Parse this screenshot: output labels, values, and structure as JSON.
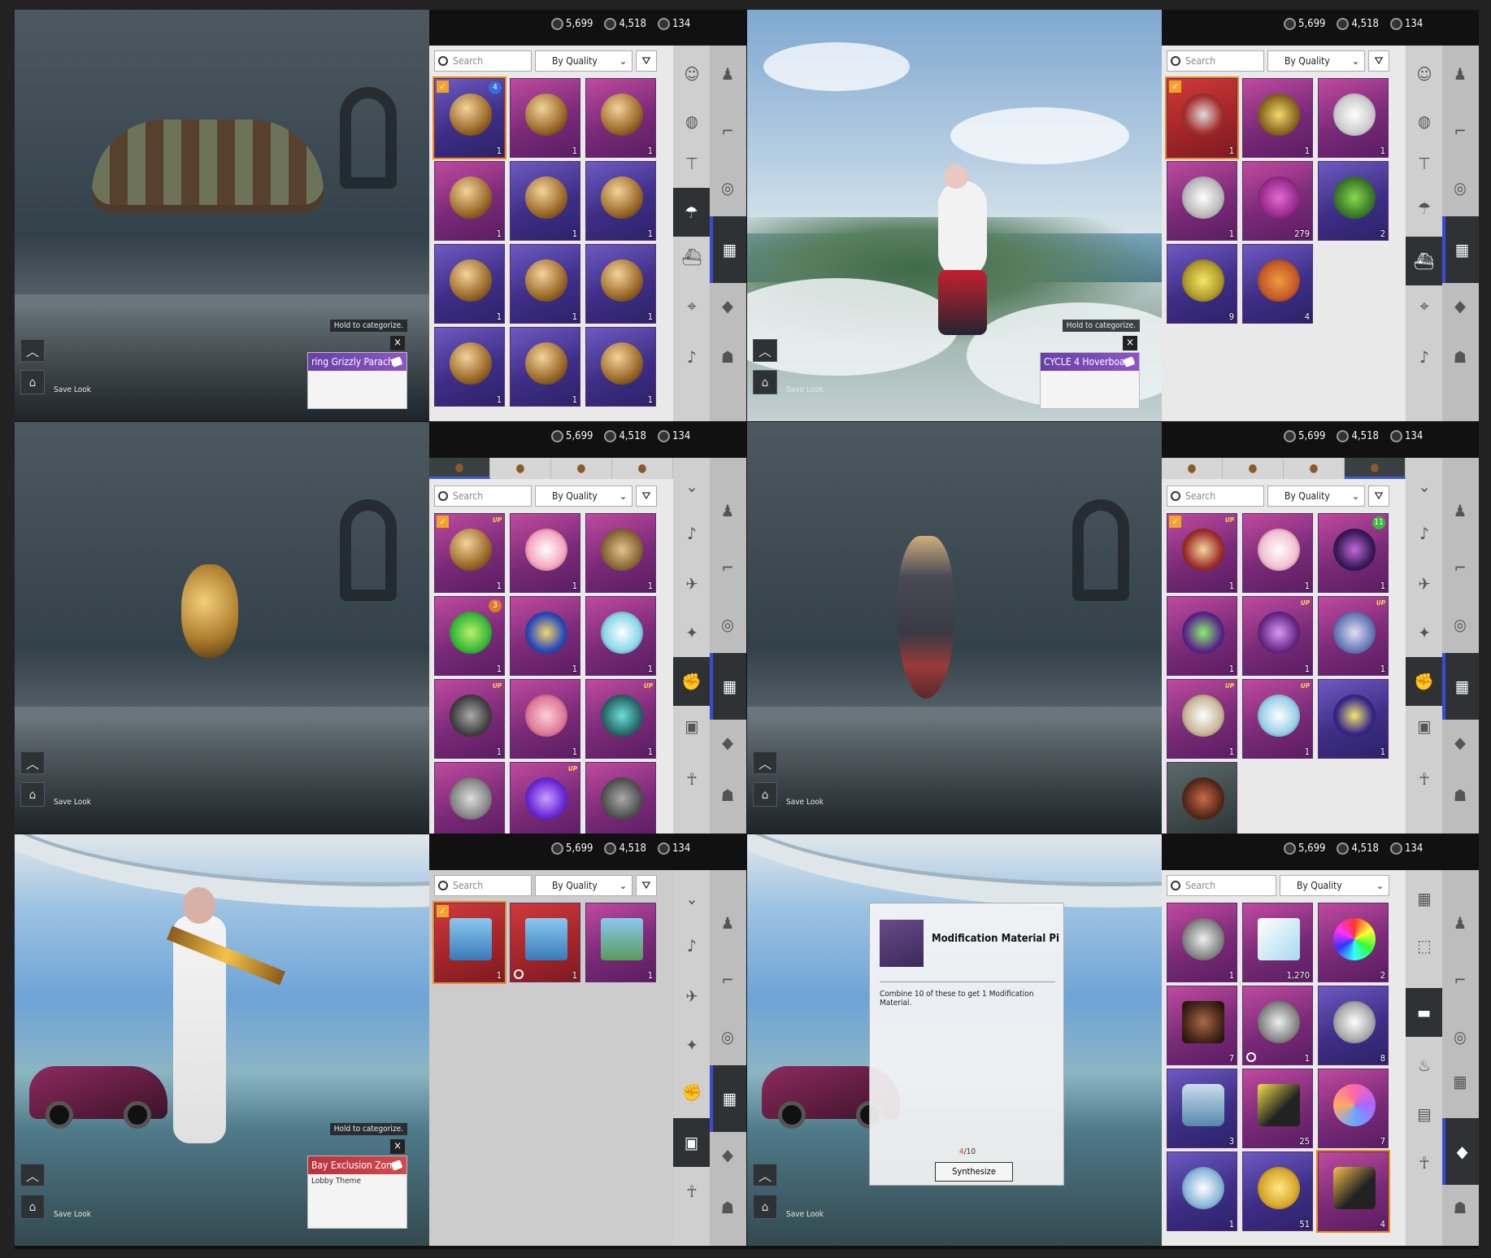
{
  "currency": {
    "uc": "5,699",
    "ag": "4,518",
    "bp": "134"
  },
  "common": {
    "search_placeholder": "Search",
    "sort_label": "By Quality",
    "save_look": "Save Look",
    "hold_hint": "Hold to categorize."
  },
  "panels": [
    {
      "id": "parachute",
      "category_item": "ring Grizzly Parach",
      "items_counts": [
        "1",
        "1",
        "1",
        "1",
        "1",
        "1",
        "1",
        "1",
        "1",
        "1",
        "1",
        "1"
      ]
    },
    {
      "id": "vehicle",
      "category_item": "CYCLE 4 Hoverboar",
      "items_counts": [
        "1",
        "1",
        "1",
        "1",
        "279",
        "2",
        "9",
        "4"
      ]
    },
    {
      "id": "grenade",
      "items_counts": [
        "1",
        "1",
        "1",
        "1",
        "1",
        "1",
        "1",
        "1",
        "1",
        "",
        "",
        ""
      ]
    },
    {
      "id": "molotov",
      "items_counts": [
        "1",
        "1",
        "1",
        "1",
        "1",
        "1",
        "1",
        "1",
        "1",
        ""
      ]
    },
    {
      "id": "lobby",
      "category_item": "Bay Exclusion Zone",
      "category_sub": "Lobby Theme",
      "items_counts": [
        "1",
        "1",
        "1"
      ]
    },
    {
      "id": "materials",
      "items_counts": [
        "1",
        "1,270",
        "2",
        "7",
        "1",
        "8",
        "3",
        "25",
        "7",
        "1",
        "51",
        "4"
      ],
      "modal": {
        "title": "Modification Material Pi",
        "desc": "Combine 10 of these to get 1 Modification Material.",
        "progress_have": "4",
        "progress_total": "/10",
        "button": "Synthesize"
      }
    }
  ],
  "badges": {
    "p1_badge": "4",
    "p3_badge": "3",
    "p4_badge": "11"
  }
}
